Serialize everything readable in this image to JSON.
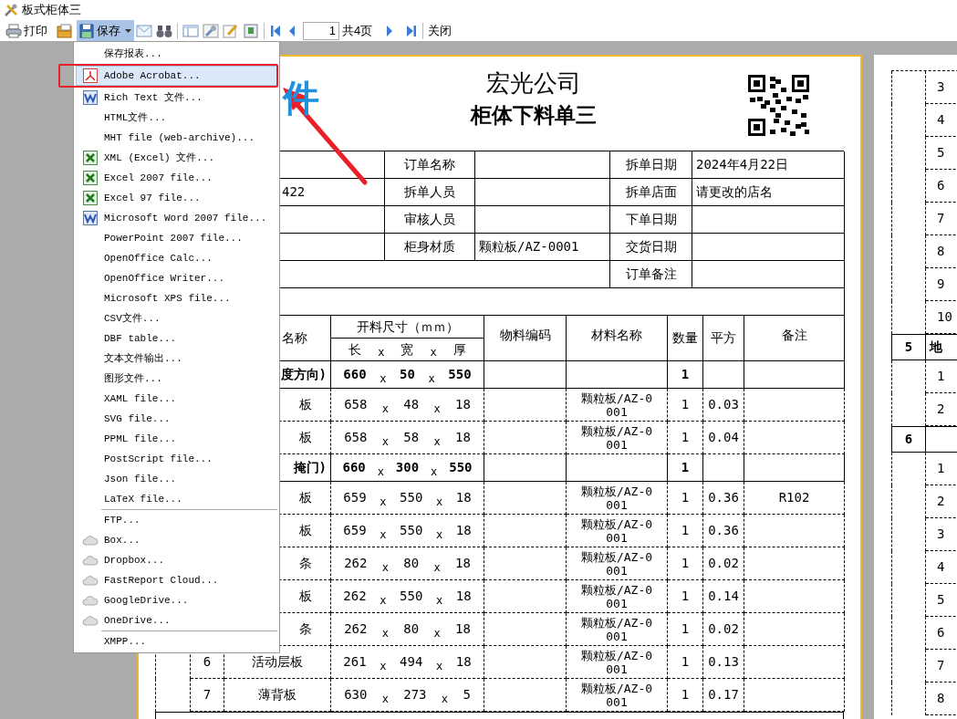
{
  "window": {
    "title": "板式柜体三"
  },
  "toolbar": {
    "print": "打印",
    "save": {
      "label": "保存",
      "selected": true
    },
    "page_field": {
      "value": "1"
    },
    "page_total": "共4页",
    "close": "关闭"
  },
  "save_menu": {
    "items": [
      {
        "kind": "plain",
        "label": "保存报表...",
        "selected": false
      },
      {
        "kind": "pdf",
        "label": "Adobe Acrobat...",
        "selected": true
      },
      {
        "kind": "word",
        "label": "Rich Text 文件...",
        "selected": false
      },
      {
        "kind": "plain",
        "label": "HTML文件...",
        "selected": false
      },
      {
        "kind": "plain",
        "label": "MHT file (web-archive)...",
        "selected": false
      },
      {
        "kind": "excel",
        "label": "XML (Excel) 文件...",
        "selected": false
      },
      {
        "kind": "excel",
        "label": "Excel 2007 file...",
        "selected": false
      },
      {
        "kind": "excel",
        "label": "Excel 97 file...",
        "selected": false
      },
      {
        "kind": "word",
        "label": "Microsoft Word 2007 file...",
        "selected": false
      },
      {
        "kind": "plain",
        "label": "PowerPoint 2007 file...",
        "selected": false
      },
      {
        "kind": "plain",
        "label": "OpenOffice Calc...",
        "selected": false
      },
      {
        "kind": "plain",
        "label": "OpenOffice Writer...",
        "selected": false
      },
      {
        "kind": "plain",
        "label": "Microsoft XPS file...",
        "selected": false
      },
      {
        "kind": "plain",
        "label": "CSV文件...",
        "selected": false
      },
      {
        "kind": "plain",
        "label": "DBF table...",
        "selected": false
      },
      {
        "kind": "plain",
        "label": "文本文件输出...",
        "selected": false
      },
      {
        "kind": "plain",
        "label": "图形文件...",
        "selected": false
      },
      {
        "kind": "plain",
        "label": "XAML file...",
        "selected": false
      },
      {
        "kind": "plain",
        "label": "SVG file...",
        "selected": false
      },
      {
        "kind": "plain",
        "label": "PPML file...",
        "selected": false
      },
      {
        "kind": "plain",
        "label": "PostScript file...",
        "selected": false
      },
      {
        "kind": "plain",
        "label": "Json file...",
        "selected": false
      },
      {
        "kind": "plain",
        "label": "LaTeX file...",
        "selected": false
      },
      {
        "kind": "separator"
      },
      {
        "kind": "plain",
        "label": "FTP...",
        "selected": false
      },
      {
        "kind": "cloud",
        "label": "Box...",
        "selected": false
      },
      {
        "kind": "cloud",
        "label": "Dropbox...",
        "selected": false
      },
      {
        "kind": "cloud",
        "label": "FastReport Cloud...",
        "selected": false
      },
      {
        "kind": "cloud",
        "label": "GoogleDrive...",
        "selected": false
      },
      {
        "kind": "cloud",
        "label": "OneDrive...",
        "selected": false
      },
      {
        "kind": "separator"
      },
      {
        "kind": "plain",
        "label": "XMPP...",
        "selected": false
      }
    ]
  },
  "report_page": {
    "logo_text": "件",
    "company": "宏光公司",
    "title": "柜体下料单三",
    "info_rows": [
      [
        "",
        "订单名称",
        "",
        "拆单日期",
        "2024年4月22日"
      ],
      [
        "422",
        "拆单人员",
        "",
        "拆单店面",
        "请更改的店名"
      ],
      [
        "",
        "审核人员",
        "",
        "下单日期",
        ""
      ],
      [
        "",
        "柜身材质",
        "颗粒板/AZ-0001",
        "交货日期",
        ""
      ]
    ],
    "remark_label": "订单备注",
    "parts_header": {
      "name": "名称",
      "size": "开料尺寸（ｍｍ）",
      "size_parts": [
        "长",
        "x",
        "宽",
        "x",
        "厚"
      ],
      "code": "物料编码",
      "material": "材料名称",
      "qty": "数量",
      "area": "平方",
      "note": "备注"
    },
    "parts_rows": [
      {
        "kind": "group",
        "name": "度方向)",
        "dims": [
          "660",
          "x",
          "50",
          "x",
          "550"
        ],
        "qty": "1"
      },
      {
        "kind": "item",
        "no": "",
        "name": "板",
        "dims": [
          "658",
          "x",
          "48",
          "x",
          "18"
        ],
        "material": "颗粒板/AZ-0001",
        "qty": "1",
        "area": "0.03"
      },
      {
        "kind": "item",
        "no": "",
        "name": "板",
        "dims": [
          "658",
          "x",
          "58",
          "x",
          "18"
        ],
        "material": "颗粒板/AZ-0001",
        "qty": "1",
        "area": "0.04"
      },
      {
        "kind": "group",
        "name": "掩门)",
        "dims": [
          "660",
          "x",
          "300",
          "x",
          "550"
        ],
        "qty": "1"
      },
      {
        "kind": "item",
        "no": "",
        "name": "板",
        "dims": [
          "659",
          "x",
          "550",
          "x",
          "18"
        ],
        "material": "颗粒板/AZ-0001",
        "qty": "1",
        "area": "0.36",
        "note": "R102"
      },
      {
        "kind": "item",
        "no": "",
        "name": "板",
        "dims": [
          "659",
          "x",
          "550",
          "x",
          "18"
        ],
        "material": "颗粒板/AZ-0001",
        "qty": "1",
        "area": "0.36"
      },
      {
        "kind": "item",
        "no": "",
        "name": "条",
        "dims": [
          "262",
          "x",
          "80",
          "x",
          "18"
        ],
        "material": "颗粒板/AZ-0001",
        "qty": "1",
        "area": "0.02"
      },
      {
        "kind": "item",
        "no": "",
        "name": "板",
        "dims": [
          "262",
          "x",
          "550",
          "x",
          "18"
        ],
        "material": "颗粒板/AZ-0001",
        "qty": "1",
        "area": "0.14"
      },
      {
        "kind": "item",
        "no": "",
        "name": "条",
        "dims": [
          "262",
          "x",
          "80",
          "x",
          "18"
        ],
        "material": "颗粒板/AZ-0001",
        "qty": "1",
        "area": "0.02"
      },
      {
        "kind": "item",
        "no": "6",
        "name": "活动层板",
        "dims": [
          "261",
          "x",
          "494",
          "x",
          "18"
        ],
        "material": "颗粒板/AZ-0001",
        "qty": "1",
        "area": "0.13"
      },
      {
        "kind": "item",
        "no": "7",
        "name": "薄背板",
        "dims": [
          "630",
          "x",
          "273",
          "x",
          "5"
        ],
        "material": "颗粒板/AZ-0001",
        "qty": "1",
        "area": "0.17"
      }
    ]
  },
  "next_page": {
    "rows": [
      {
        "kind": "item",
        "no": "3"
      },
      {
        "kind": "item",
        "no": "4"
      },
      {
        "kind": "item",
        "no": "5"
      },
      {
        "kind": "item",
        "no": "6"
      },
      {
        "kind": "item",
        "no": "7"
      },
      {
        "kind": "item",
        "no": "8"
      },
      {
        "kind": "item",
        "no": "9"
      },
      {
        "kind": "item",
        "no": "10"
      },
      {
        "kind": "group",
        "no": "5",
        "name": "地"
      },
      {
        "kind": "item",
        "no": "1"
      },
      {
        "kind": "item",
        "no": "2"
      },
      {
        "kind": "group",
        "no": "6",
        "name": ""
      },
      {
        "kind": "item",
        "no": "1"
      },
      {
        "kind": "item",
        "no": "2"
      },
      {
        "kind": "item",
        "no": "3"
      },
      {
        "kind": "item",
        "no": "4"
      },
      {
        "kind": "item",
        "no": "5"
      },
      {
        "kind": "item",
        "no": "6"
      },
      {
        "kind": "item",
        "no": "7"
      },
      {
        "kind": "item",
        "no": "8"
      }
    ]
  }
}
